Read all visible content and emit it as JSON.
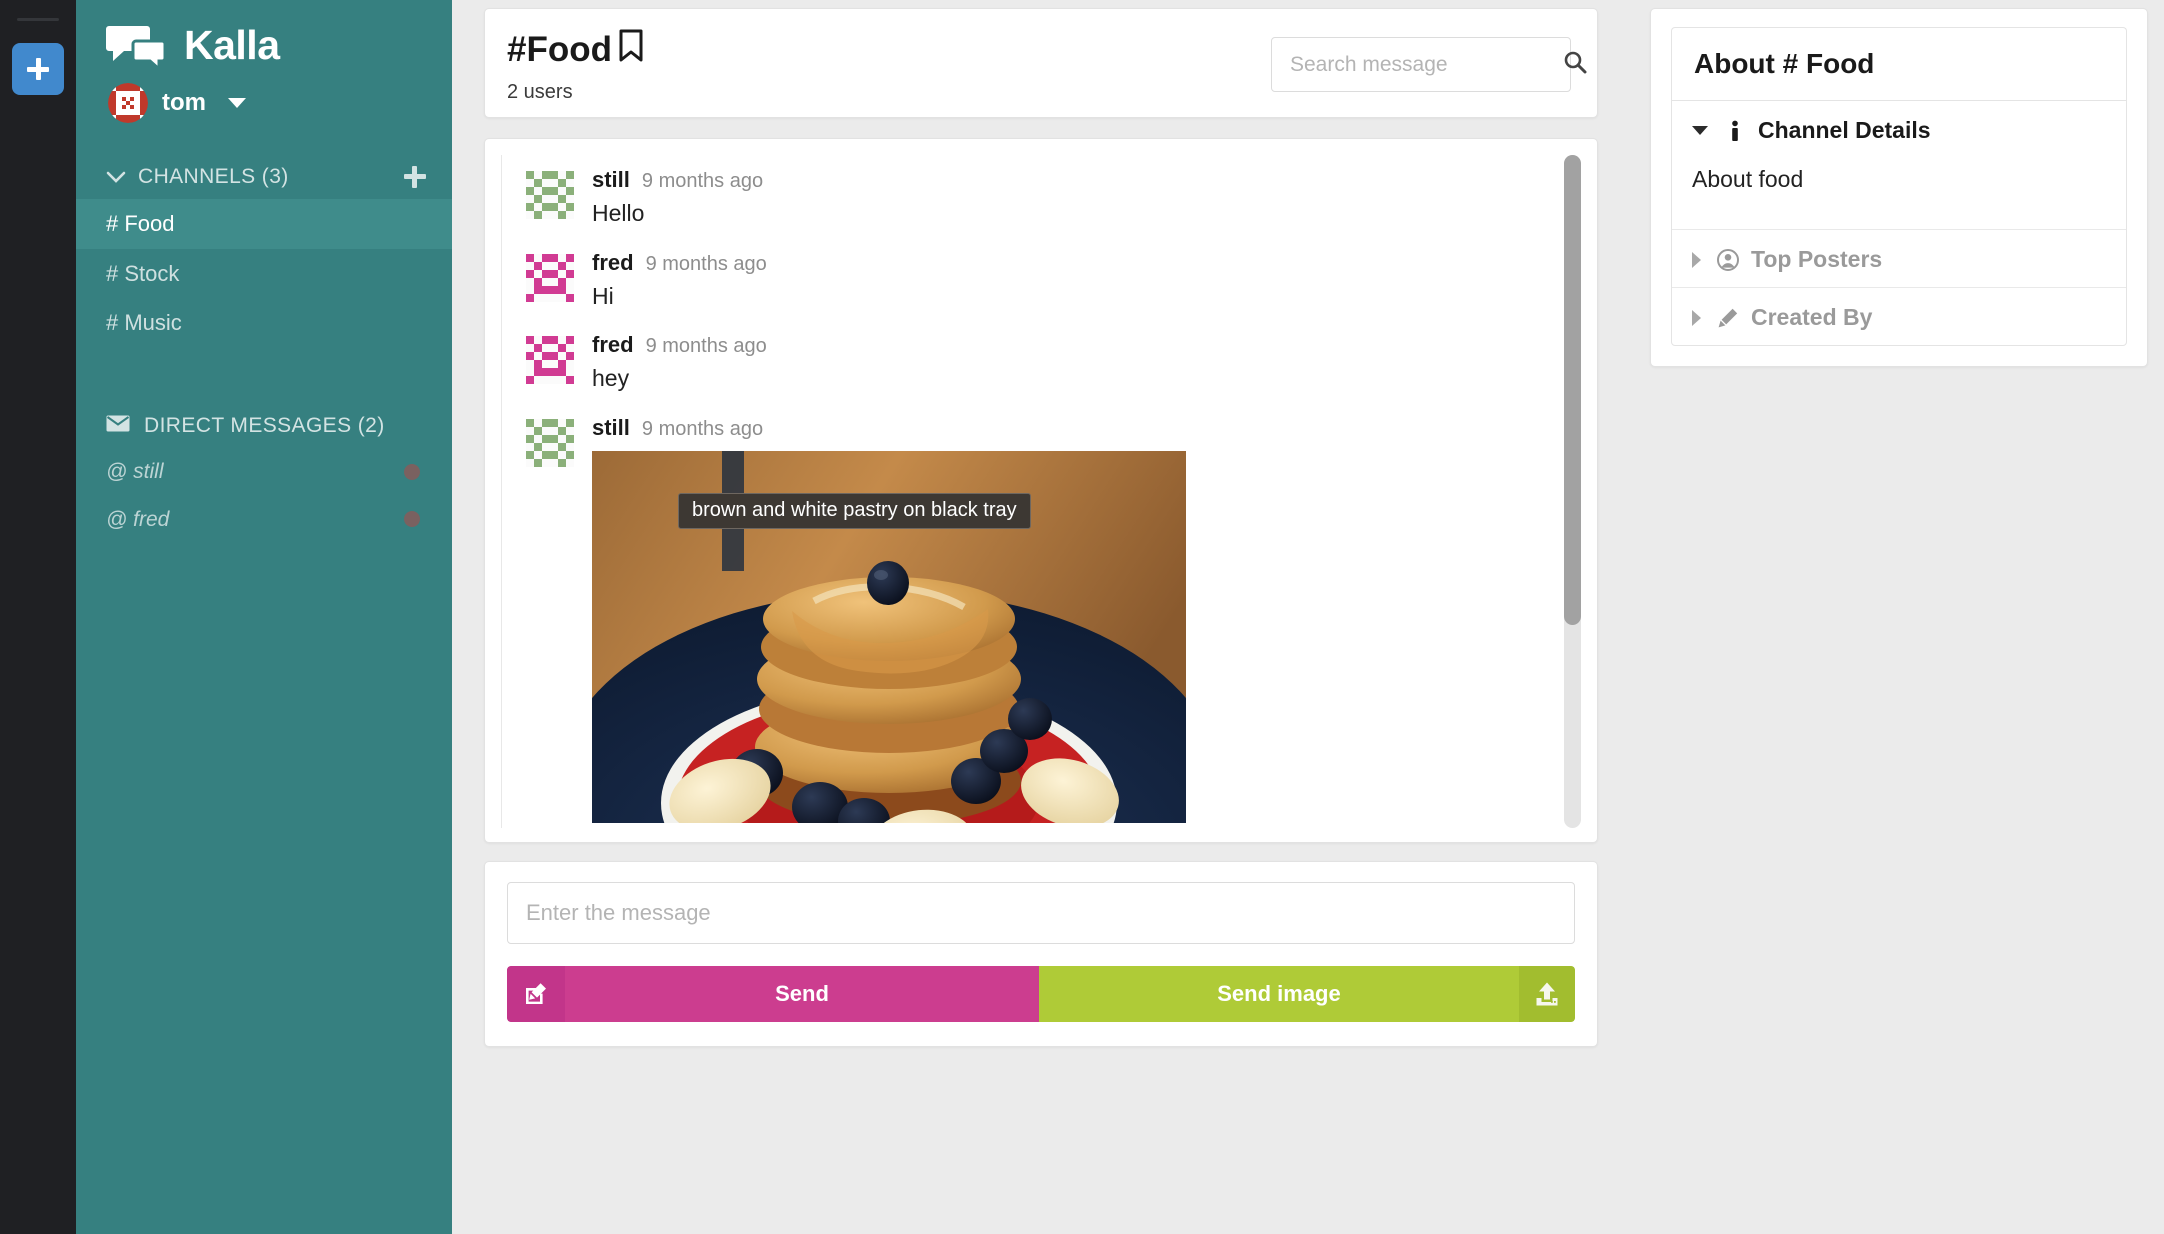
{
  "rail": {
    "add_button_label": "+",
    "accent_color": "#4189cd"
  },
  "sidebar": {
    "brand": "Kalla",
    "brand_logo_icon": "chat-bubbles-icon",
    "background_color": "#368080",
    "current_user": {
      "name": "tom",
      "avatar_icon": "identicon-avatar-red"
    },
    "channels_section": {
      "label": "CHANNELS (3)",
      "collapse_icon": "chevron-down-icon",
      "add_icon": "plus-icon",
      "items": [
        {
          "label": "# Food",
          "active": true
        },
        {
          "label": "# Stock",
          "active": false
        },
        {
          "label": "# Music",
          "active": false
        }
      ]
    },
    "direct_messages_section": {
      "label": "DIRECT MESSAGES (2)",
      "mail_icon": "envelope-icon",
      "items": [
        {
          "label": "@ still",
          "status_color": "#7a6160"
        },
        {
          "label": "@ fred",
          "status_color": "#7a6160"
        }
      ]
    }
  },
  "channel_header": {
    "title": "#Food",
    "bookmark_icon": "bookmark-icon",
    "user_count": "2 users",
    "search": {
      "placeholder": "Search message",
      "value": "",
      "icon": "search-icon"
    }
  },
  "messages": [
    {
      "author": "still",
      "time": "9 months ago",
      "text": "Hello",
      "avatar_icon": "identicon-avatar-green",
      "avatar_color": "#8bb07a"
    },
    {
      "author": "fred",
      "time": "9 months ago",
      "text": "Hi",
      "avatar_icon": "identicon-avatar-pink",
      "avatar_color": "#d13b93"
    },
    {
      "author": "fred",
      "time": "9 months ago",
      "text": "hey",
      "avatar_icon": "identicon-avatar-pink",
      "avatar_color": "#d13b93"
    },
    {
      "author": "still",
      "time": "9 months ago",
      "text": "",
      "avatar_icon": "identicon-avatar-green",
      "avatar_color": "#8bb07a",
      "image_alt": "brown and white pastry on black tray"
    }
  ],
  "composer": {
    "placeholder": "Enter the message",
    "value": "",
    "send_label": "Send",
    "send_icon": "compose-icon",
    "send_color": "#cc3d8f",
    "send_image_label": "Send image",
    "send_image_icon": "upload-icon",
    "send_image_color": "#afcb37"
  },
  "about_panel": {
    "title": "About # Food",
    "sections": [
      {
        "label": "Channel Details",
        "icon": "info-icon",
        "expanded": true,
        "body": "About food"
      },
      {
        "label": "Top Posters",
        "icon": "person-circle-icon",
        "expanded": false,
        "body": ""
      },
      {
        "label": "Created By",
        "icon": "pencil-icon",
        "expanded": false,
        "body": ""
      }
    ]
  }
}
